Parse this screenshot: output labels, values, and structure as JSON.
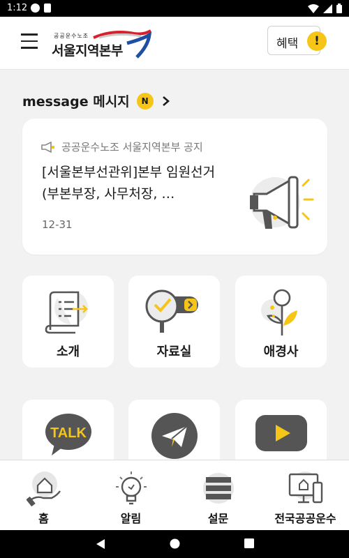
{
  "status_bar": {
    "time": "1:12"
  },
  "header": {
    "logo_small": "공공운수노조",
    "logo_big": "서울지역본부",
    "benefit_label": "혜택",
    "benefit_badge": "!"
  },
  "message_section": {
    "title": "message 메시지",
    "badge": "N",
    "card": {
      "source": "공공운수노조 서울지역본부 공지",
      "title_line1": "[서울본부선관위]본부 임원선거",
      "title_line2": "(부본부장, 사무처장, …",
      "date": "12-31"
    }
  },
  "tiles": [
    {
      "label": "소개",
      "icon": "document-list-icon"
    },
    {
      "label": "자료실",
      "icon": "magnifier-check-icon"
    },
    {
      "label": "애경사",
      "icon": "flower-icon"
    },
    {
      "label": "",
      "icon": "kakaotalk-icon",
      "icon_text": "TALK"
    },
    {
      "label": "",
      "icon": "telegram-icon"
    },
    {
      "label": "",
      "icon": "youtube-icon"
    }
  ],
  "bottom_nav": [
    {
      "label": "홈",
      "icon": "home-hand-icon"
    },
    {
      "label": "알림",
      "icon": "lightbulb-icon"
    },
    {
      "label": "설문",
      "icon": "survey-stack-icon"
    },
    {
      "label": "전국공공운수",
      "icon": "computer-monitor-icon"
    }
  ],
  "colors": {
    "accent": "#f5c518",
    "icon_gray": "#666666",
    "background": "#f2f2f2"
  }
}
